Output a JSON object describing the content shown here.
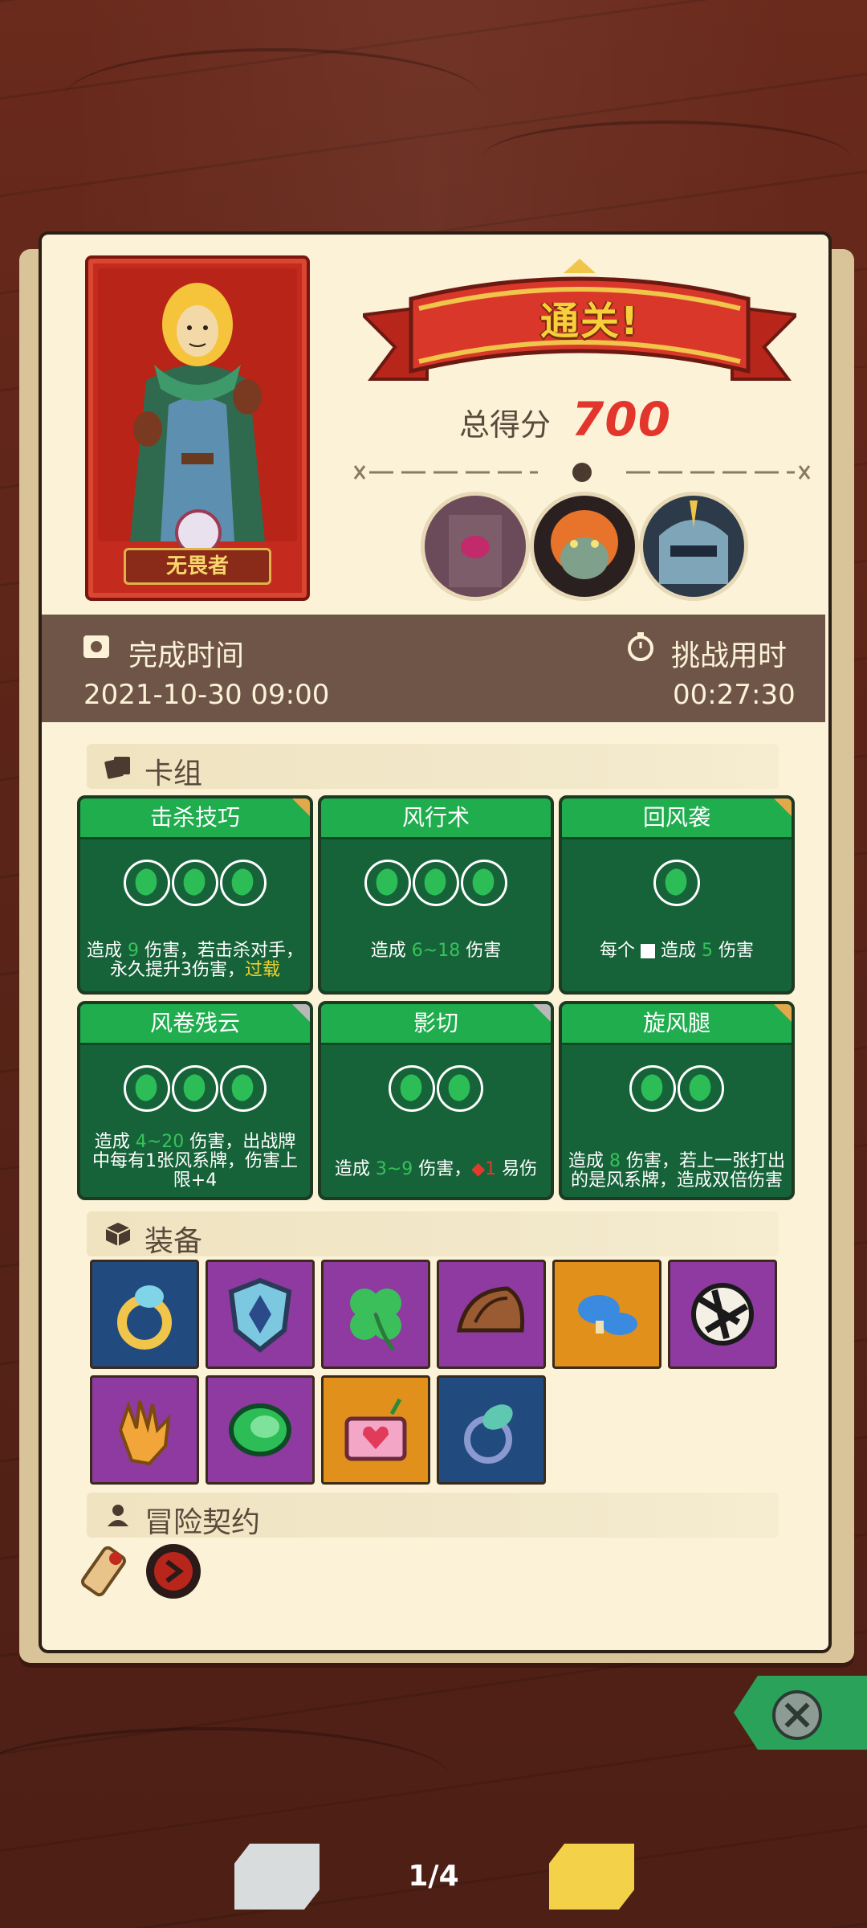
{
  "result": {
    "banner": "通关!",
    "score_label": "总得分",
    "score_value": "700"
  },
  "hero": {
    "name": "无畏者"
  },
  "bosses": [
    {
      "icon": "stone-golem-boss-portrait"
    },
    {
      "icon": "orange-ogre-boss-portrait"
    },
    {
      "icon": "armored-knight-boss-portrait"
    }
  ],
  "info": {
    "complete_time_label": "完成时间",
    "complete_time_value": "2021-10-30 09:00",
    "challenge_time_label": "挑战用时",
    "challenge_time_value": "00:27:30"
  },
  "deck": {
    "title": "卡组",
    "cards": [
      {
        "name": "击杀技巧",
        "cost": 3,
        "desc_a": "造成 ",
        "value": "9",
        "desc_b": " 伤害，若击杀对手，永久提升3伤害，",
        "extra": "过载",
        "corner": "gold"
      },
      {
        "name": "风行术",
        "cost": 3,
        "desc_a": "造成 ",
        "value": "6~18",
        "desc_b": " 伤害",
        "extra": "",
        "corner": "none"
      },
      {
        "name": "回风袭",
        "cost": 1,
        "desc_a": "每个 ",
        "value": "",
        "desc_b": " 造成 ",
        "value2": "5",
        "desc_c": " 伤害",
        "corner": "gold"
      },
      {
        "name": "风卷残云",
        "cost": 3,
        "desc_a": "造成 ",
        "value": "4~20",
        "desc_b": " 伤害，出战牌中每有1张风系牌，伤害上限+4",
        "extra": "",
        "corner": "silver"
      },
      {
        "name": "影切",
        "cost": 2,
        "desc_a": "造成 ",
        "value": "3~9",
        "desc_b": " 伤害，",
        "vuln": "1",
        "desc_c": " 易伤",
        "corner": "silver"
      },
      {
        "name": "旋风腿",
        "cost": 2,
        "desc_a": "造成 ",
        "value": "8",
        "desc_b": " 伤害，若上一张打出的是风系牌，造成双倍伤害",
        "extra": "",
        "corner": "gold"
      }
    ]
  },
  "equipment": {
    "title": "装备",
    "items": [
      {
        "icon": "gold-ring-icon",
        "rarity_color": "#214a7e"
      },
      {
        "icon": "blue-shield-icon",
        "rarity_color": "#8e3aa0"
      },
      {
        "icon": "four-leaf-clover-icon",
        "rarity_color": "#8e3aa0"
      },
      {
        "icon": "leather-shoulder-pad-icon",
        "rarity_color": "#8e3aa0"
      },
      {
        "icon": "blue-mushroom-icon",
        "rarity_color": "#e2901c"
      },
      {
        "icon": "torn-scroll-icon",
        "rarity_color": "#8e3aa0"
      },
      {
        "icon": "glove-icon",
        "rarity_color": "#8e3aa0"
      },
      {
        "icon": "green-leaf-icon",
        "rarity_color": "#8e3aa0"
      },
      {
        "icon": "heart-box-icon",
        "rarity_color": "#e2901c"
      },
      {
        "icon": "leaf-ring-icon",
        "rarity_color": "#214a7e"
      }
    ]
  },
  "contract": {
    "title": "冒险契约",
    "items": [
      {
        "icon": "scroll-contract-icon"
      },
      {
        "icon": "red-rune-badge-icon"
      }
    ]
  },
  "pager": {
    "text": "1/4"
  },
  "colors": {
    "panel": "#fbf2d8",
    "card_green": "#16633a",
    "card_header": "#1fad4e",
    "score_red": "#e2352b",
    "banner_gold": "#f6cf3a"
  }
}
